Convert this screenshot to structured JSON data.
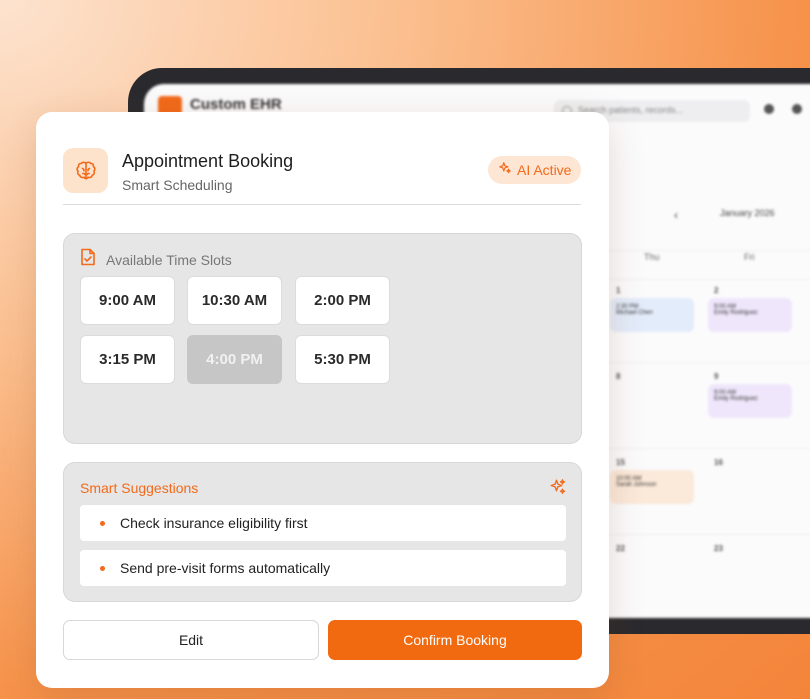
{
  "background_app": {
    "title": "Custom EHR",
    "search_placeholder": "Search patients, records...",
    "month": "January 2026",
    "prev_icon": "‹",
    "day_names": [
      "Thu",
      "Fri"
    ],
    "dates": [
      "1",
      "2",
      "8",
      "9",
      "15",
      "16",
      "22",
      "23"
    ],
    "events": [
      {
        "time": "2:30 PM",
        "name": "Michael Chen"
      },
      {
        "time": "9:00 AM",
        "name": "Emily Rodriguez"
      },
      {
        "time": "9:00 AM",
        "name": "Emily Rodriguez"
      },
      {
        "time": "10:00 AM",
        "name": "Sarah Johnson"
      }
    ]
  },
  "card": {
    "title": "Appointment Booking",
    "subtitle": "Smart Scheduling",
    "badge": "AI Active",
    "slots": {
      "header": "Available Time Slots",
      "items": [
        {
          "label": "9:00 AM",
          "state": "available"
        },
        {
          "label": "10:30 AM",
          "state": "available"
        },
        {
          "label": "2:00 PM",
          "state": "available"
        },
        {
          "label": "3:15 PM",
          "state": "available"
        },
        {
          "label": "4:00 PM",
          "state": "unavailable"
        },
        {
          "label": "5:30 PM",
          "state": "available"
        }
      ]
    },
    "suggestions": {
      "title": "Smart Suggestions",
      "items": [
        "Check insurance eligibility first",
        "Send pre-visit forms automatically"
      ]
    },
    "buttons": {
      "edit": "Edit",
      "confirm": "Confirm Booking"
    }
  },
  "colors": {
    "accent": "#f26a1b",
    "accent_light": "#fde3cc",
    "panel": "#e6e6e6",
    "slot_disabled": "#c6c6c6"
  },
  "icons": {
    "brand": "brain-icon",
    "badge": "sparkle-icon",
    "slots": "calendar-check-icon",
    "suggestions": "sparkle-icon"
  }
}
